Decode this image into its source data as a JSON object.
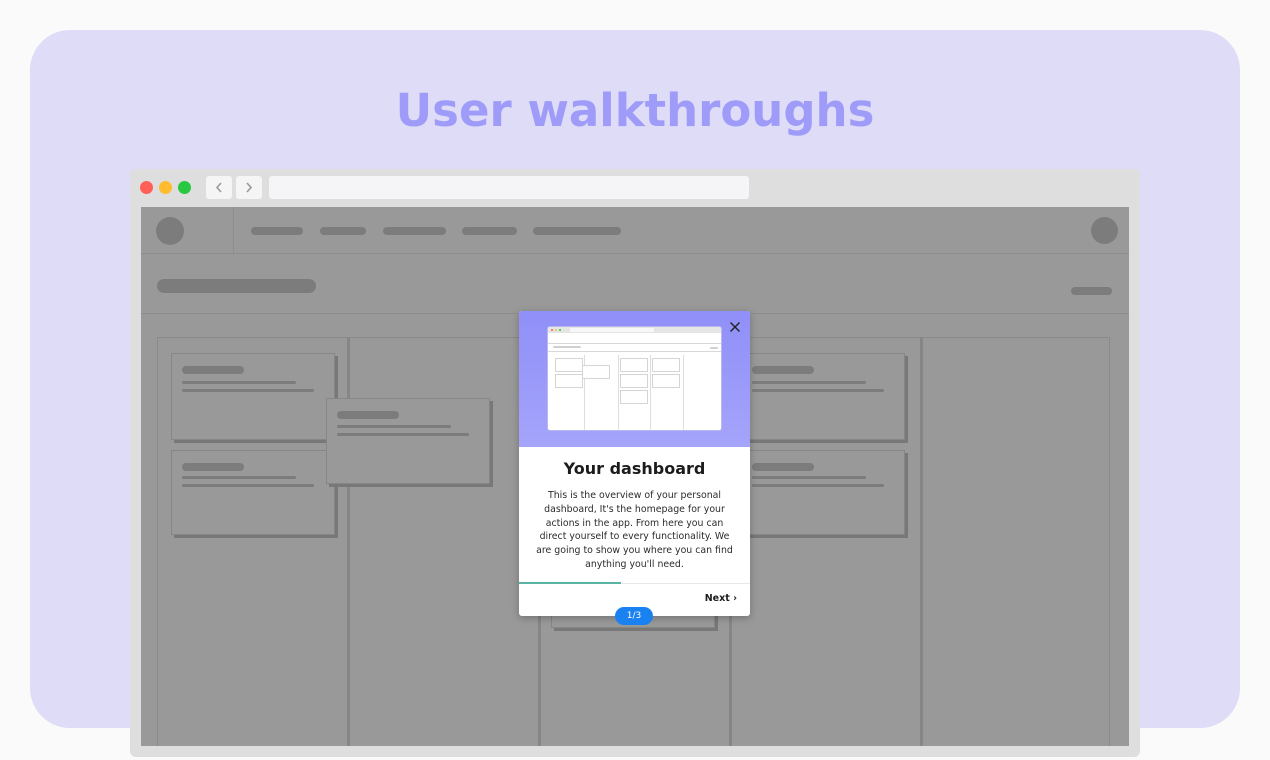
{
  "hero": {
    "title": "User walkthroughs"
  },
  "browser": {
    "back_icon": "chevron-left-icon",
    "forward_icon": "chevron-right-icon",
    "url": ""
  },
  "walkthrough": {
    "title": "Your dashboard",
    "body": "This is the overview of your personal dashboard, It's the homepage for your actions in the app. From here you can direct yourself to every functionality. We are going to show you where you can find anything you'll need.",
    "next_label": "Next ›",
    "step_label": "1/3",
    "progress": 0.44,
    "close_icon": "close-icon"
  },
  "colors": {
    "stage_bg": "#dedcf6",
    "title": "#9f9cf9",
    "hero_gradient_top": "#8f8ff8",
    "accent": "#1a82f0",
    "progress": "#5ab4a3"
  }
}
